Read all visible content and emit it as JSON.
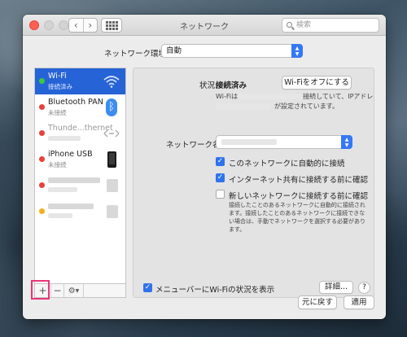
{
  "window": {
    "title": "ネットワーク",
    "search_placeholder": "検索"
  },
  "location": {
    "label": "ネットワーク環境:",
    "value": "自動"
  },
  "services": [
    {
      "name": "Wi-Fi",
      "status": "接続済み",
      "dot_color": "#3ec93e",
      "selected": true
    },
    {
      "name": "Bluetooth PAN",
      "status": "未接続",
      "dot_color": "#e8413b"
    },
    {
      "name": "Thunde...thernet",
      "status": "",
      "dot_color": "#e8413b"
    },
    {
      "name": "iPhone USB",
      "status": "未接続",
      "dot_color": "#e8413b"
    },
    {
      "name": "",
      "status": "",
      "dot_color": "#e8413b"
    },
    {
      "name": "",
      "status": "",
      "dot_color": "#f2b020"
    }
  ],
  "toolbar": {
    "add": "+",
    "remove": "−",
    "action": "⚙"
  },
  "detail": {
    "status_label": "状況:",
    "status_value": "接続済み",
    "wifi_off_button": "Wi-Fiをオフにする",
    "status_desc_line1": "Wi-Fiは　　　　　　　　　に接続していて、IPアドレス",
    "status_desc_line2": "　　　　　　　　　が設定されています。",
    "network_name_label": "ネットワーク名:",
    "auto_join": "このネットワークに自動的に接続",
    "ask_hotspot": "インターネット共有に接続する前に確認",
    "ask_new": "新しいネットワークに接続する前に確認",
    "ask_new_desc_1": "接続したことのあるネットワークに自動的に接続され",
    "ask_new_desc_2": "ます。接続したことのあるネットワークに接続できな",
    "ask_new_desc_3": "い場合は、手動でネットワークを選択する必要があり",
    "ask_new_desc_4": "ます。",
    "menubar_status": "メニューバーにWi-Fiの状況を表示",
    "advanced_button": "詳細...",
    "help_button": "?"
  },
  "footer": {
    "revert_button": "元に戻す",
    "apply_button": "適用"
  },
  "colors": {
    "accent": "#2663d6",
    "checkbox": "#2f73ec"
  }
}
